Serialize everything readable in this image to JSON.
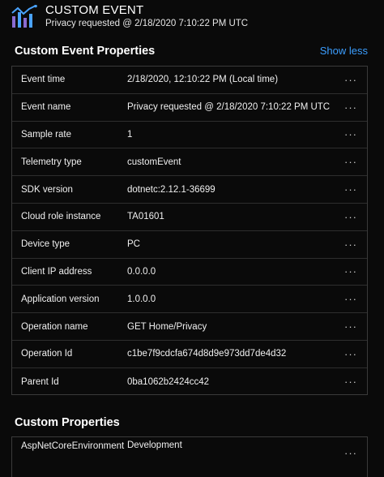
{
  "header": {
    "icon": "event-bar-chart-icon",
    "title": "CUSTOM EVENT",
    "subtitle": "Privacy requested @ 2/18/2020 7:10:22 PM UTC"
  },
  "event_section": {
    "title": "Custom Event Properties",
    "toggle_label": "Show less",
    "rows": [
      {
        "label": "Event time",
        "value": "2/18/2020, 12:10:22 PM (Local time)"
      },
      {
        "label": "Event name",
        "value": "Privacy requested @ 2/18/2020 7:10:22 PM UTC"
      },
      {
        "label": "Sample rate",
        "value": "1"
      },
      {
        "label": "Telemetry type",
        "value": "customEvent"
      },
      {
        "label": "SDK version",
        "value": "dotnetc:2.12.1-36699"
      },
      {
        "label": "Cloud role instance",
        "value": "TA01601"
      },
      {
        "label": "Device type",
        "value": "PC"
      },
      {
        "label": "Client IP address",
        "value": "0.0.0.0"
      },
      {
        "label": "Application version",
        "value": "1.0.0.0"
      },
      {
        "label": "Operation name",
        "value": "GET Home/Privacy"
      },
      {
        "label": "Operation Id",
        "value": "c1be7f9cdcfa674d8d9e973dd7de4d32"
      },
      {
        "label": "Parent Id",
        "value": "0ba1062b2424cc42"
      }
    ],
    "more_glyph": "···"
  },
  "custom_section": {
    "title": "Custom Properties",
    "rows": [
      {
        "label": "AspNetCoreEnvironment",
        "value": "Development"
      }
    ]
  },
  "colors": {
    "background": "#0a0a0a",
    "accent_link": "#3b9eff",
    "icon_blue": "#4aa3ff",
    "icon_purple": "#8a6bd1"
  }
}
